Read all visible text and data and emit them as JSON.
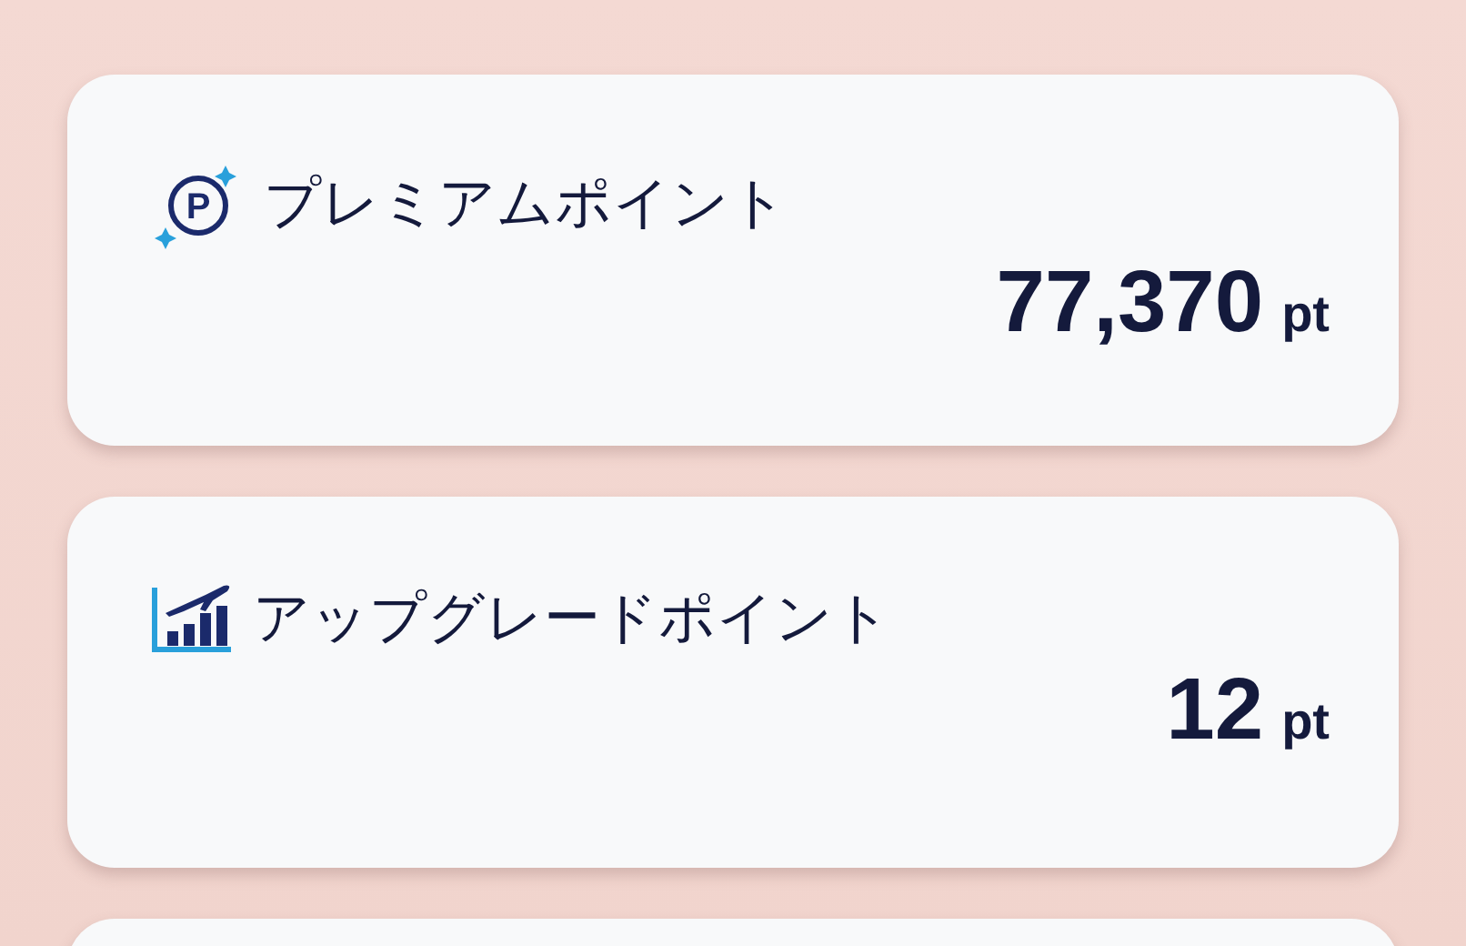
{
  "cards": [
    {
      "kind": "premium",
      "icon_letter": "P",
      "title": "プレミアムポイント",
      "value": "77,370",
      "unit": "pt"
    },
    {
      "kind": "upgrade",
      "title": "アップグレードポイント",
      "value": "12",
      "unit": "pt"
    }
  ]
}
